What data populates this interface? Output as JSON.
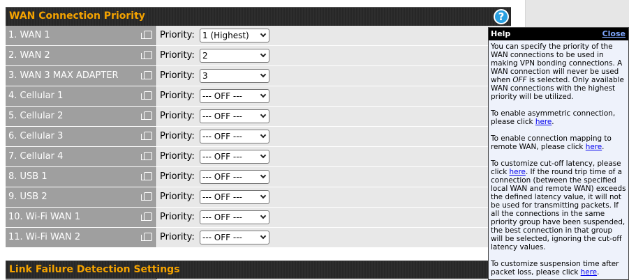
{
  "wan_section": {
    "title": "WAN Connection Priority",
    "help_icon": "?",
    "priority_label": "Priority:",
    "rows": [
      {
        "label": "1. WAN 1",
        "priority": "1 (Highest)"
      },
      {
        "label": "2. WAN 2",
        "priority": "2"
      },
      {
        "label": "3. WAN 3 MAX ADAPTER",
        "priority": "3"
      },
      {
        "label": "4. Cellular 1",
        "priority": "--- OFF ---"
      },
      {
        "label": "5. Cellular 2",
        "priority": "--- OFF ---"
      },
      {
        "label": "6. Cellular 3",
        "priority": "--- OFF ---"
      },
      {
        "label": "7. Cellular 4",
        "priority": "--- OFF ---"
      },
      {
        "label": "8. USB 1",
        "priority": "--- OFF ---"
      },
      {
        "label": "9. USB 2",
        "priority": "--- OFF ---"
      },
      {
        "label": "10. Wi-Fi WAN 1",
        "priority": "--- OFF ---"
      },
      {
        "label": "11. Wi-Fi WAN 2",
        "priority": "--- OFF ---"
      }
    ]
  },
  "link_section": {
    "title": "Link Failure Detection Settings"
  },
  "help_panel": {
    "title": "Help",
    "close": "Close",
    "p1_a": "You can specify the priority of the WAN connections to be used in making VPN bonding connections. A WAN connection will never be used when ",
    "p1_em": "OFF",
    "p1_b": " is selected. Only available WAN connections with the highest priority will be utilized.",
    "p2_a": "To enable asymmetric connection, please click ",
    "p2_link": "here",
    "p2_b": ".",
    "p3_a": "To enable connection mapping to remote WAN, please click ",
    "p3_link": "here",
    "p3_b": ".",
    "p4_a": "To customize cut-off latency, please click ",
    "p4_link": "here",
    "p4_b": ". If the round trip time of a connection (between the specified local WAN and remote WAN) exceeds the defined latency value, it will not be used for transmitting packets. If all the connections in the same priority group have been suspended, the best connection in that group will be selected, ignoring the cut-off latency values.",
    "p5_a": "To customize suspension time after packet loss, please click ",
    "p5_link": "here",
    "p5_b": "."
  },
  "colors": {
    "header_bg": "#2e2e2e",
    "header_text": "#f5a300",
    "label_bg": "#9f9f9f",
    "value_bg": "#e8e8e8",
    "help_bg": "#eef2fb",
    "link": "#0000ee"
  }
}
